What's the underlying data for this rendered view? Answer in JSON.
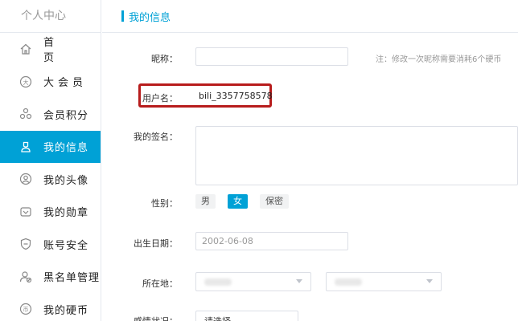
{
  "sidebar": {
    "title": "个人中心",
    "items": [
      {
        "label": "首 页",
        "icon": "home-icon"
      },
      {
        "label": "大会员",
        "icon": "vip-icon"
      },
      {
        "label": "会员积分",
        "icon": "points-icon"
      },
      {
        "label": "我的信息",
        "icon": "user-icon",
        "active": true
      },
      {
        "label": "我的头像",
        "icon": "avatar-icon"
      },
      {
        "label": "我的勋章",
        "icon": "medal-icon"
      },
      {
        "label": "账号安全",
        "icon": "shield-icon"
      },
      {
        "label": "黑名单管理",
        "icon": "blacklist-icon"
      },
      {
        "label": "我的硬币",
        "icon": "coin-icon"
      }
    ]
  },
  "main": {
    "title": "我的信息",
    "nickname": {
      "label": "昵称：",
      "value": "",
      "note": "注：修改一次昵称需要消耗6个硬币"
    },
    "username": {
      "label": "用户名：",
      "value": "bili_3357758578"
    },
    "signature": {
      "label": "我的签名：",
      "value": ""
    },
    "gender": {
      "label": "性别：",
      "options": [
        "男",
        "女",
        "保密"
      ],
      "selected": "女"
    },
    "birthday": {
      "label": "出生日期：",
      "value": "2002-06-08"
    },
    "location": {
      "label": "所在地："
    },
    "relationship": {
      "label": "感情状况：",
      "value": "请选择"
    }
  },
  "colors": {
    "accent": "#00a1d6",
    "highlight": "#b71c1c"
  }
}
